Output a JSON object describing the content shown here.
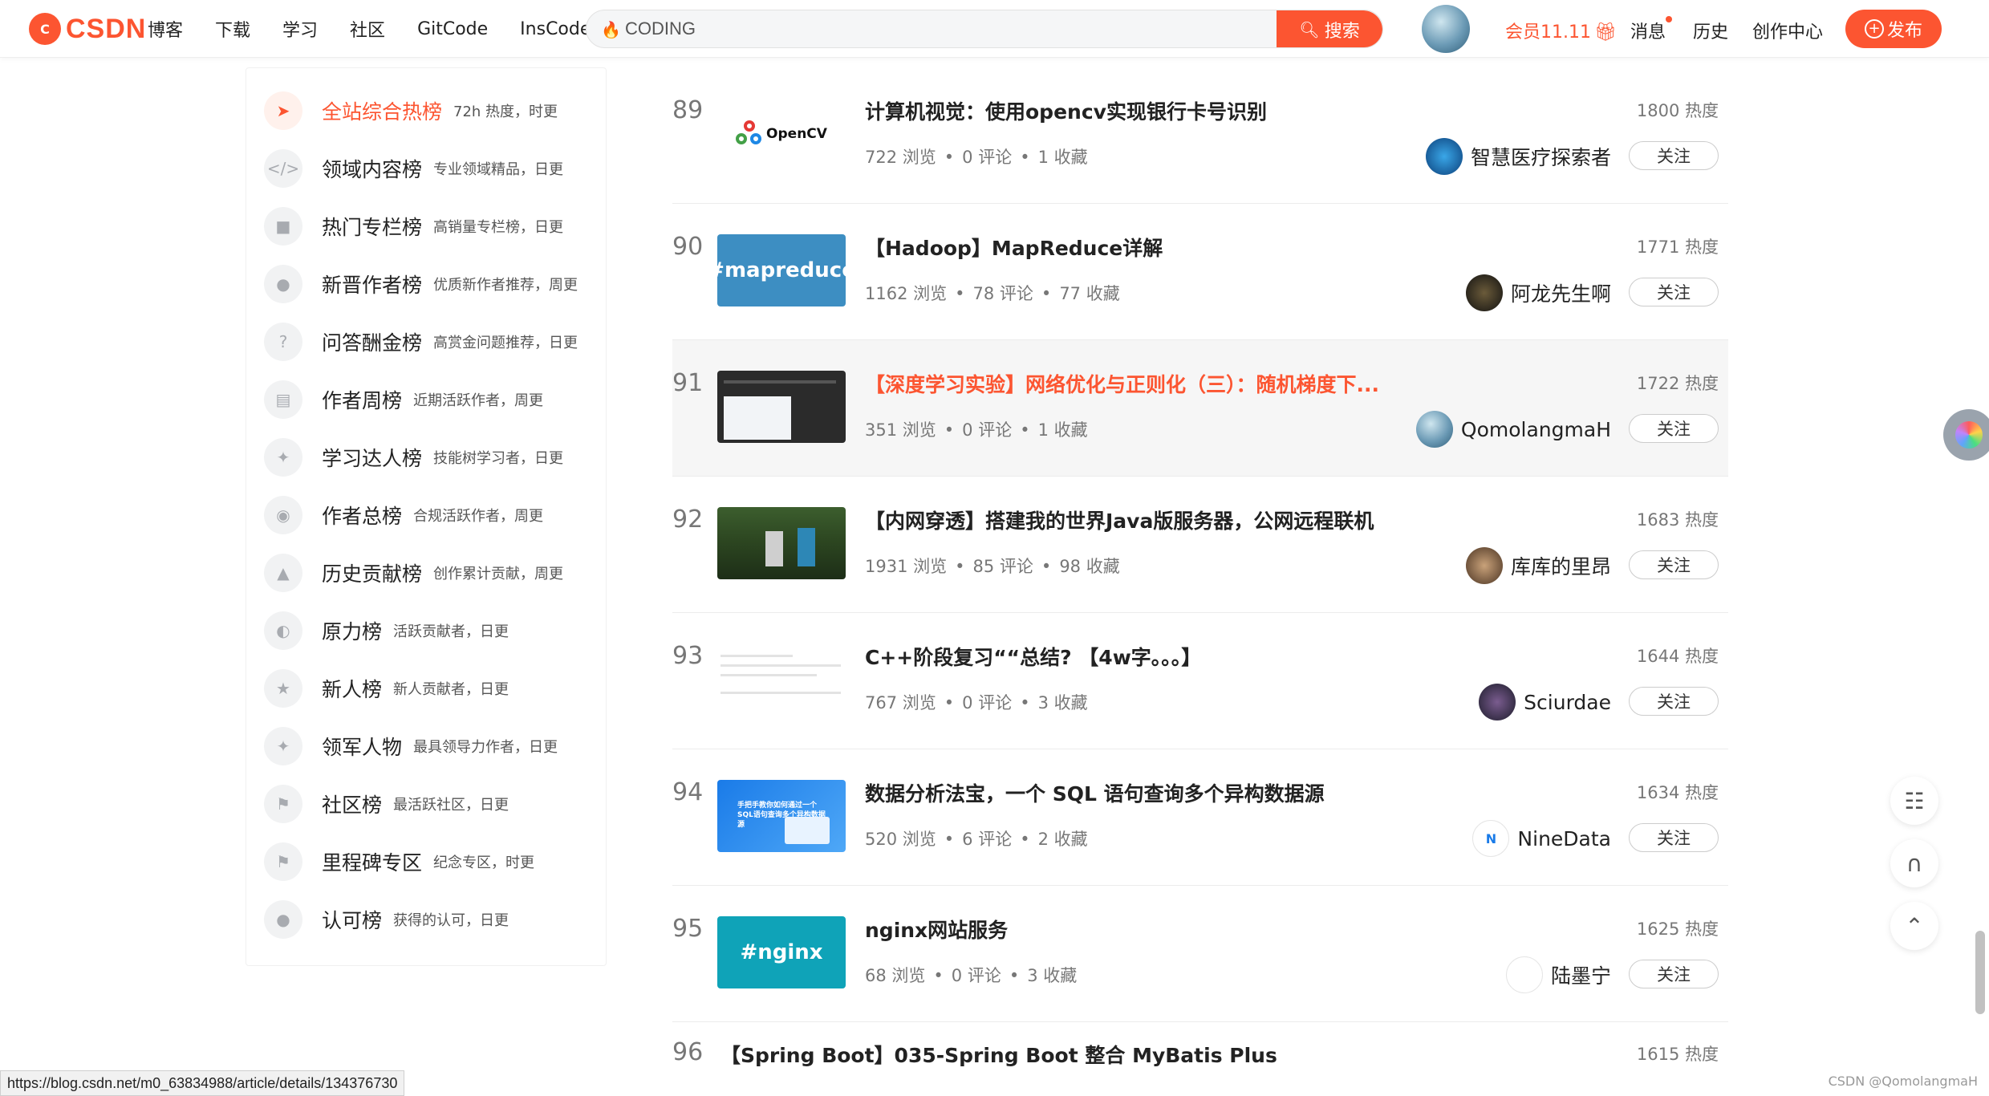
{
  "nav": {
    "logo_text": "CSDN",
    "items": [
      "博客",
      "下载",
      "学习",
      "社区",
      "GitCode",
      "InsCode"
    ],
    "search_value": "CODING",
    "search_button": "搜索",
    "vip": "会员11.11",
    "messages": "消息",
    "history": "历史",
    "creator": "创作中心",
    "publish": "发布"
  },
  "sidebar": {
    "items": [
      {
        "name": "全站综合热榜",
        "desc": "72h 热度，时更",
        "icon": "rocket-icon",
        "active": true
      },
      {
        "name": "领域内容榜",
        "desc": "专业领域精品，日更",
        "icon": "code-icon"
      },
      {
        "name": "热门专栏榜",
        "desc": "高销量专栏榜，日更",
        "icon": "book-icon"
      },
      {
        "name": "新晋作者榜",
        "desc": "优质新作者推荐，周更",
        "icon": "user-icon"
      },
      {
        "name": "问答酬金榜",
        "desc": "高赏金问题推荐，日更",
        "icon": "question-icon"
      },
      {
        "name": "作者周榜",
        "desc": "近期活跃作者，周更",
        "icon": "week-icon"
      },
      {
        "name": "学习达人榜",
        "desc": "技能树学习者，日更",
        "icon": "medal-icon"
      },
      {
        "name": "作者总榜",
        "desc": "合规活跃作者，周更",
        "icon": "group-icon"
      },
      {
        "name": "历史贡献榜",
        "desc": "创作累计贡献，周更",
        "icon": "trophy-icon"
      },
      {
        "name": "原力榜",
        "desc": "活跃贡献者，日更",
        "icon": "force-icon"
      },
      {
        "name": "新人榜",
        "desc": "新人贡献者，日更",
        "icon": "newbie-icon"
      },
      {
        "name": "领军人物",
        "desc": "最具领导力作者，日更",
        "icon": "leader-icon"
      },
      {
        "name": "社区榜",
        "desc": "最活跃社区，日更",
        "icon": "flag-icon"
      },
      {
        "name": "里程碑专区",
        "desc": "纪念专区，时更",
        "icon": "milestone-icon"
      },
      {
        "name": "认可榜",
        "desc": "获得的认可，日更",
        "icon": "approve-icon"
      }
    ]
  },
  "list": {
    "rows": [
      {
        "rank": "89",
        "title": "计算机视觉：使用opencv实现银行卡号识别",
        "views": "722 浏览",
        "comments": "0 评论",
        "favs": "1 收藏",
        "heat": "1800 热度",
        "author": "智慧医疗探索者",
        "follow": "关注",
        "thumb": "opencv",
        "thumb_text": "OpenCV"
      },
      {
        "rank": "90",
        "title": "【Hadoop】MapReduce详解",
        "views": "1162 浏览",
        "comments": "78 评论",
        "favs": "77 收藏",
        "heat": "1771 热度",
        "author": "阿龙先生啊",
        "follow": "关注",
        "thumb": "tag",
        "thumb_text": "#mapreduce"
      },
      {
        "rank": "91",
        "title": "【深度学习实验】网络优化与正则化（三）：随机梯度下...",
        "views": "351 浏览",
        "comments": "0 评论",
        "favs": "1 收藏",
        "heat": "1722 热度",
        "author": "QomolangmaH",
        "follow": "关注",
        "thumb": "dark",
        "thumb_text": ""
      },
      {
        "rank": "92",
        "title": "【内网穿透】搭建我的世界Java版服务器，公网远程联机",
        "views": "1931 浏览",
        "comments": "85 评论",
        "favs": "98 收藏",
        "heat": "1683 热度",
        "author": "库库的里昂",
        "follow": "关注",
        "thumb": "mc",
        "thumb_text": ""
      },
      {
        "rank": "93",
        "title": "C++阶段复习““总结? 【4w字。。。】",
        "views": "767 浏览",
        "comments": "0 评论",
        "favs": "3 收藏",
        "heat": "1644 热度",
        "author": "Sciurdae",
        "follow": "关注",
        "thumb": "doc",
        "thumb_text": ""
      },
      {
        "rank": "94",
        "title": "数据分析法宝，一个 SQL 语句查询多个异构数据源",
        "views": "520 浏览",
        "comments": "6 评论",
        "favs": "2 收藏",
        "heat": "1634 热度",
        "author": "NineData",
        "follow": "关注",
        "thumb": "sql",
        "thumb_text": "手把手教你如何通过一个SQL语句查询多个异构数据源"
      },
      {
        "rank": "95",
        "title": "nginx网站服务",
        "views": "68 浏览",
        "comments": "0 评论",
        "favs": "3 收藏",
        "heat": "1625 热度",
        "author": "陆墨宁",
        "follow": "关注",
        "thumb": "tag-nginx",
        "thumb_text": "#nginx"
      }
    ],
    "last_row": {
      "rank": "96",
      "title": "【Spring Boot】035-Spring Boot 整合 MyBatis Plus",
      "heat": "1615 热度"
    }
  },
  "status_url": "https://blog.csdn.net/m0_63834988/article/details/134376730",
  "watermark": "CSDN @QomolangmaH",
  "colors": {
    "accent": "#fc5531"
  }
}
